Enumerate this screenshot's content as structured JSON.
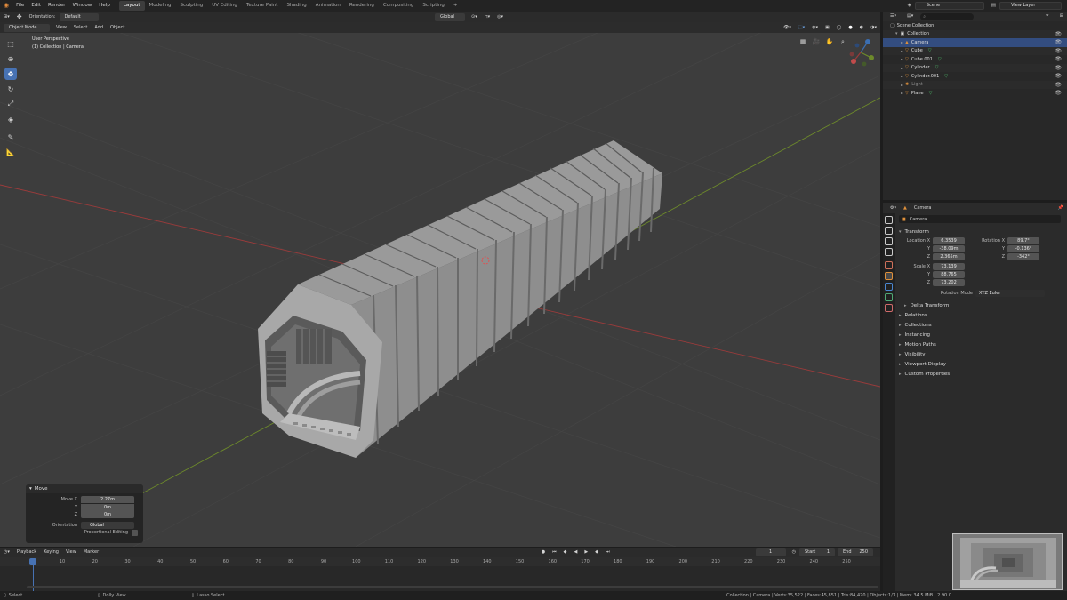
{
  "menubar": {
    "menus": [
      "File",
      "Edit",
      "Render",
      "Window",
      "Help"
    ],
    "workspaces": [
      "Layout",
      "Modeling",
      "Sculpting",
      "UV Editing",
      "Texture Paint",
      "Shading",
      "Animation",
      "Rendering",
      "Compositing",
      "Scripting"
    ],
    "active_workspace": "Layout",
    "add_tab": "+",
    "scene": "Scene",
    "view_layer": "View Layer"
  },
  "tool_header": {
    "orientation_label": "Orientation:",
    "orientation_value": "Default",
    "transform_orientation": "Global"
  },
  "viewport_header": {
    "mode": "Object Mode",
    "menus": [
      "View",
      "Select",
      "Add",
      "Object"
    ]
  },
  "viewport": {
    "view_name": "User Perspective",
    "view_sub": "(1) Collection | Camera",
    "axis_colors": {
      "x": "#9a3b3b",
      "y": "#6d8a2b",
      "z": "#3b6fb3"
    }
  },
  "operator_panel": {
    "title": "Move",
    "rows": [
      {
        "label": "Move X",
        "value": "2.27m"
      },
      {
        "label": "Y",
        "value": "0m"
      },
      {
        "label": "Z",
        "value": "0m"
      }
    ],
    "orientation_label": "Orientation",
    "orientation_value": "Global",
    "proportional_label": "Proportional Editing"
  },
  "timeline": {
    "menus": [
      "Playback",
      "Keying",
      "View",
      "Marker"
    ],
    "current_frame": "1",
    "start_label": "Start",
    "start_value": "1",
    "end_label": "End",
    "end_value": "250",
    "ticks": [
      "1",
      "10",
      "20",
      "30",
      "40",
      "50",
      "60",
      "70",
      "80",
      "90",
      "100",
      "110",
      "120",
      "130",
      "140",
      "150",
      "160",
      "170",
      "180",
      "190",
      "200",
      "210",
      "220",
      "230",
      "240",
      "250"
    ]
  },
  "statusbar": {
    "select": "Select",
    "dolly": "Dolly View",
    "lasso": "Lasso Select",
    "info": "Collection | Camera | Verts:35,522 | Faces:45,851 | Tris:84,470 | Objects:1/7 | Mem: 34.5 MiB | 2.90.0"
  },
  "outliner": {
    "root": "Scene Collection",
    "collection": "Collection",
    "items": [
      {
        "name": "Camera",
        "icon": "camera-icon",
        "color": "#e0913b",
        "selected": true
      },
      {
        "name": "Cube",
        "icon": "mesh-icon",
        "color": "#e0913b",
        "selected": false
      },
      {
        "name": "Cube.001",
        "icon": "mesh-icon",
        "color": "#e0913b",
        "selected": false
      },
      {
        "name": "Cylinder",
        "icon": "mesh-icon",
        "color": "#e0913b",
        "selected": false
      },
      {
        "name": "Cylinder.001",
        "icon": "mesh-icon",
        "color": "#e0913b",
        "selected": false
      },
      {
        "name": "Light",
        "icon": "light-icon",
        "color": "#e0913b",
        "selected": false
      },
      {
        "name": "Plane",
        "icon": "mesh-icon",
        "color": "#e0913b",
        "selected": false
      }
    ]
  },
  "properties": {
    "breadcrumb": "Camera",
    "object_name": "Camera",
    "transform_title": "Transform",
    "location_label": "Location X",
    "location": [
      "6.3539",
      "-38.09m",
      "2.365m"
    ],
    "rotation_label": "Rotation X",
    "rotation": [
      "89.7°",
      "-0.136°",
      "-342°"
    ],
    "scale_label": "Scale X",
    "scale": [
      "73.139",
      "88.765",
      "73.202"
    ],
    "axis_y": "Y",
    "axis_z": "Z",
    "rotation_mode_label": "Rotation Mode",
    "rotation_mode_value": "XYZ Euler",
    "delta_transform": "Delta Transform",
    "sections": [
      "Relations",
      "Collections",
      "Instancing",
      "Motion Paths",
      "Visibility",
      "Viewport Display",
      "Custom Properties"
    ]
  }
}
